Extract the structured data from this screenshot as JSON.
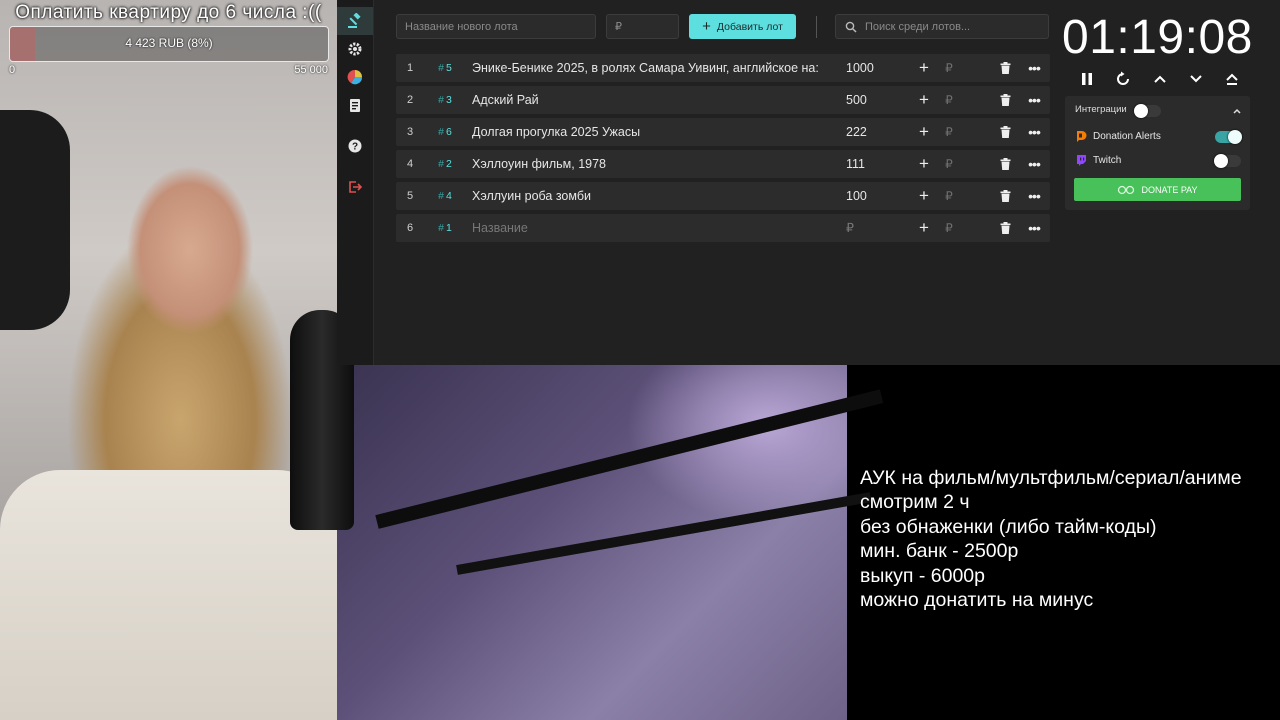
{
  "goal": {
    "title": "Оплатить квартиру до 6 числа :((",
    "progress_text": "4 423 RUB (8%)",
    "progress_fraction": 0.08,
    "min": "0",
    "max": "55 000"
  },
  "toolbar": {
    "lot_name_placeholder": "Название нового лота",
    "lot_amount_placeholder": "₽",
    "add_lot_label": "Добавить лот",
    "search_placeholder": "Поиск среди лотов..."
  },
  "lots": [
    {
      "num": "1",
      "tag": "5",
      "name": "Энике-Бенике 2025,  в ролях Самара Уивинг, английское на:",
      "amount": "1000",
      "rub": "₽"
    },
    {
      "num": "2",
      "tag": "3",
      "name": "Адский Рай",
      "amount": "500",
      "rub": "₽"
    },
    {
      "num": "3",
      "tag": "6",
      "name": "Долгая прогулка 2025 Ужасы",
      "amount": "222",
      "rub": "₽"
    },
    {
      "num": "4",
      "tag": "2",
      "name": "Хэллоуин фильм, 1978",
      "amount": "111",
      "rub": "₽"
    },
    {
      "num": "5",
      "tag": "4",
      "name": "Хэллуин роба зомби",
      "amount": "100",
      "rub": "₽"
    },
    {
      "num": "6",
      "tag": "1",
      "name": "Название",
      "amount": "₽",
      "rub": "₽"
    }
  ],
  "timer": {
    "value": "01:19:08"
  },
  "integrations": {
    "header": "Интеграции",
    "donation_alerts": "Donation Alerts",
    "twitch": "Twitch",
    "donate_pay": "DONATE PAY"
  },
  "rules": [
    "АУК на фильм/мультфильм/сериал/аниме",
    "смотрим 2 ч",
    "без обнаженки (либо тайм-коды)",
    "мин. банк - 2500р",
    "выкуп - 6000р",
    "можно донатить на минус"
  ],
  "colors": {
    "accent": "#5ddfe0",
    "donate_pay": "#48c15a",
    "logout": "#e05050"
  }
}
